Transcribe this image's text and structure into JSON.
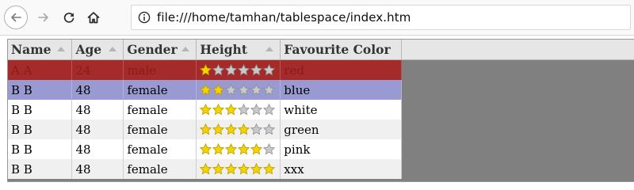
{
  "browser": {
    "url": "file:///home/tamhan/tablespace/index.htm"
  },
  "table": {
    "columns": [
      "Name",
      "Age",
      "Gender",
      "Height",
      "Favourite Color"
    ],
    "rows": [
      {
        "name": "A A",
        "age": "24",
        "gender": "male",
        "height_stars": 1,
        "color": "red",
        "state": "selected"
      },
      {
        "name": "B B",
        "age": "48",
        "gender": "female",
        "height_stars": 2,
        "color": "blue",
        "state": "hover"
      },
      {
        "name": "B B",
        "age": "48",
        "gender": "female",
        "height_stars": 3,
        "color": "white",
        "state": "odd"
      },
      {
        "name": "B B",
        "age": "48",
        "gender": "female",
        "height_stars": 4,
        "color": "green",
        "state": "even"
      },
      {
        "name": "B B",
        "age": "48",
        "gender": "female",
        "height_stars": 5,
        "color": "pink",
        "state": "odd"
      },
      {
        "name": "B B",
        "age": "48",
        "gender": "female",
        "height_stars": 6,
        "color": "xxx",
        "state": "even"
      }
    ],
    "star_max": 6,
    "colors": {
      "star_filled": "#f5d300",
      "star_empty": "#c9c9c9",
      "selected_row": "#a52a2a",
      "hover_row": "#9a9ad2",
      "grid_background": "#808080"
    }
  },
  "icons": {
    "back": "back-arrow-icon",
    "forward": "forward-arrow-icon",
    "reload": "reload-icon",
    "home": "home-icon",
    "site_info": "site-info-icon",
    "sort": "sort-ascending-icon",
    "star": "star-icon"
  }
}
